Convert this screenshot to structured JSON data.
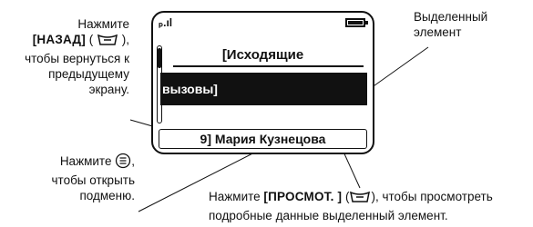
{
  "callouts": {
    "back": {
      "line1": "Нажмите",
      "key": "[НАЗАД]",
      "line3": "чтобы вернуться к",
      "line4": "предыдущему",
      "line5": "экрану."
    },
    "selected": {
      "line1": "Выделенный",
      "line2": "элемент"
    },
    "menu": {
      "line1": "Нажмите",
      "line2": "чтобы открыть",
      "line3": "подменю."
    },
    "view": {
      "prefix": "Нажмите",
      "key": "[ПРОСМОТ. ]",
      "suffix": ", чтобы просмотреть",
      "line2": "подробные данные выделенный элемент."
    }
  },
  "screen": {
    "signal": "ₚ.ıl",
    "title": "[Исходящие",
    "highlighted_item": "вызовы]",
    "softkey_item": "9] Мария Кузнецова",
    "menu_glyph": "≡"
  },
  "colors": {
    "ink": "#111111",
    "background": "#ffffff",
    "highlight": "#111111"
  },
  "icons": {
    "soft_key_left": "left-soft-key-icon",
    "soft_key_right": "right-soft-key-icon",
    "menu_key": "menu-key-icon",
    "battery": "battery-icon",
    "signal": "signal-strength-icon"
  }
}
